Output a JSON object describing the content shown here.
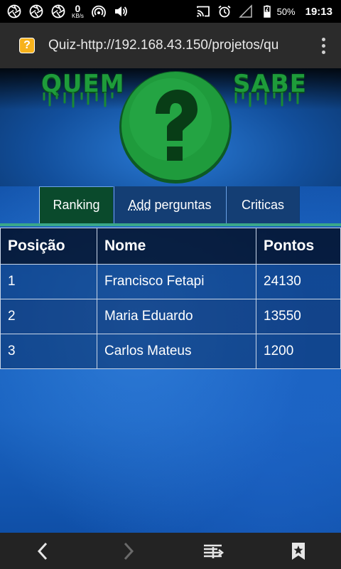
{
  "status_bar": {
    "net_speed_value": "0",
    "net_speed_unit": "KB/s",
    "battery_percent": "50%",
    "time": "19:13",
    "icons": [
      "aperture-icon",
      "aperture-icon",
      "aperture-icon",
      "hotspot-icon",
      "volume-icon",
      "cast-icon",
      "alarm-icon",
      "signal-icon",
      "battery-icon"
    ]
  },
  "browser": {
    "url": "Quiz-http://192.168.43.150/projetos/qu",
    "favicon": "?",
    "menu_icon": "overflow-menu-icon"
  },
  "banner": {
    "logo_word_left": "QUEM",
    "logo_word_right": "SABE",
    "logo_symbol": "?",
    "logo_color": "#1f9b3c"
  },
  "tabs": [
    {
      "label_abbr": "",
      "label": "Ranking",
      "active": true
    },
    {
      "label_abbr": "Add",
      "label": " perguntas",
      "active": false
    },
    {
      "label_abbr": "",
      "label": "Criticas",
      "active": false
    }
  ],
  "ranking": {
    "headers": [
      "Posição",
      "Nome",
      "Pontos"
    ],
    "rows": [
      [
        "1",
        "Francisco Fetapi",
        "24130"
      ],
      [
        "2",
        "Maria Eduardo",
        "13550"
      ],
      [
        "3",
        "Carlos Mateus",
        "1200"
      ]
    ]
  },
  "nav": {
    "icons": [
      "back-icon",
      "forward-icon",
      "reader-mode-icon",
      "bookmarks-icon"
    ]
  },
  "colors": {
    "accent_green": "#1f9b3c",
    "teal_line": "#3aa88a",
    "active_tab": "#0a4a2c"
  }
}
